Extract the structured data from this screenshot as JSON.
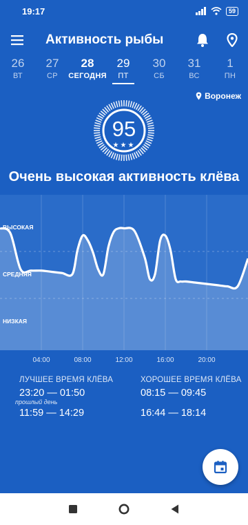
{
  "status": {
    "time": "19:17",
    "battery": "59",
    "icons": [
      "signal-icon",
      "wifi-icon",
      "battery-icon"
    ]
  },
  "app_bar": {
    "title": "Активность рыбы",
    "icons": [
      "menu-icon",
      "bell-icon",
      "location-pin-icon"
    ]
  },
  "days": [
    {
      "num": "26",
      "label": "ВТ"
    },
    {
      "num": "27",
      "label": "СР"
    },
    {
      "num": "28",
      "label": "СЕГОДНЯ"
    },
    {
      "num": "29",
      "label": "ПТ"
    },
    {
      "num": "30",
      "label": "СБ"
    },
    {
      "num": "31",
      "label": "ВС"
    },
    {
      "num": "1",
      "label": "ПН"
    }
  ],
  "location": {
    "name": "Воронеж"
  },
  "score": {
    "value": "95",
    "stars": "★★★"
  },
  "headline": "Очень высокая активность клёва",
  "chart_data": {
    "type": "area",
    "y_levels": [
      "ВЫСОКАЯ",
      "СРЕДНЯЯ",
      "НИЗКАЯ"
    ],
    "x_ticks": [
      "04:00",
      "08:00",
      "12:00",
      "16:00",
      "20:00"
    ],
    "x_range_hours": [
      0,
      24
    ],
    "grid": true,
    "series": [
      {
        "x_hours": [
          0,
          1,
          2,
          3,
          4,
          5,
          6,
          7,
          7.5,
          8,
          8.5,
          9,
          9.5,
          10,
          10.5,
          11,
          11.5,
          12,
          13,
          14,
          14.5,
          15,
          15.5,
          16,
          16.5,
          17,
          17.5,
          18,
          19,
          20,
          21,
          22,
          23,
          24
        ],
        "activity": [
          0.9,
          0.86,
          0.56,
          0.55,
          0.55,
          0.54,
          0.53,
          0.52,
          0.72,
          0.84,
          0.8,
          0.7,
          0.56,
          0.52,
          0.75,
          0.87,
          0.9,
          0.9,
          0.88,
          0.66,
          0.48,
          0.52,
          0.8,
          0.84,
          0.72,
          0.48,
          0.46,
          0.46,
          0.45,
          0.44,
          0.43,
          0.42,
          0.42,
          0.65
        ]
      }
    ]
  },
  "best_times": {
    "heading": "ЛУЧШЕЕ ВРЕМЯ КЛЁВА",
    "row1": "23:20  —  01:50",
    "note": "прошлый день",
    "row2": "11:59  —  14:29"
  },
  "good_times": {
    "heading": "ХОРОШЕЕ ВРЕМЯ КЛЁВА",
    "row1": "08:15  —  09:45",
    "row2": "16:44  —  18:14"
  },
  "fab": {
    "icon": "calendar-icon"
  },
  "nav": {
    "icons": [
      "recent-apps-icon",
      "home-icon",
      "back-icon"
    ]
  }
}
